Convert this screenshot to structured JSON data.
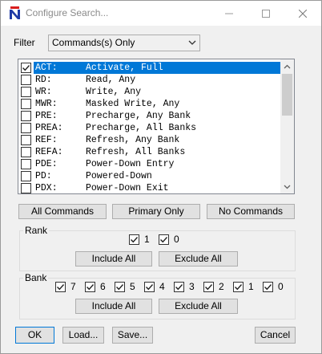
{
  "window": {
    "title": "Configure Search..."
  },
  "filter": {
    "label": "Filter",
    "selected": "Commands(s) Only"
  },
  "commands": [
    {
      "code": "ACT:",
      "desc": "Activate, Full",
      "checked": true,
      "selected": true
    },
    {
      "code": "RD:",
      "desc": "Read, Any",
      "checked": false,
      "selected": false
    },
    {
      "code": "WR:",
      "desc": "Write, Any",
      "checked": false,
      "selected": false
    },
    {
      "code": "MWR:",
      "desc": "Masked Write, Any",
      "checked": false,
      "selected": false
    },
    {
      "code": "PRE:",
      "desc": "Precharge, Any Bank",
      "checked": false,
      "selected": false
    },
    {
      "code": "PREA:",
      "desc": "Precharge, All Banks",
      "checked": false,
      "selected": false
    },
    {
      "code": "REF:",
      "desc": "Refresh, Any Bank",
      "checked": false,
      "selected": false
    },
    {
      "code": "REFA:",
      "desc": "Refresh, All Banks",
      "checked": false,
      "selected": false
    },
    {
      "code": "PDE:",
      "desc": "Power-Down Entry",
      "checked": false,
      "selected": false
    },
    {
      "code": "PD:",
      "desc": "Powered-Down",
      "checked": false,
      "selected": false
    },
    {
      "code": "PDX:",
      "desc": "Power-Down Exit",
      "checked": false,
      "selected": false
    }
  ],
  "selection_buttons": {
    "all": "All Commands",
    "primary": "Primary Only",
    "none": "No Commands"
  },
  "rank": {
    "label": "Rank",
    "items": [
      {
        "label": "1",
        "checked": true
      },
      {
        "label": "0",
        "checked": true
      }
    ],
    "include_all": "Include All",
    "exclude_all": "Exclude All"
  },
  "bank": {
    "label": "Bank",
    "items": [
      {
        "label": "7",
        "checked": true
      },
      {
        "label": "6",
        "checked": true
      },
      {
        "label": "5",
        "checked": true
      },
      {
        "label": "4",
        "checked": true
      },
      {
        "label": "3",
        "checked": true
      },
      {
        "label": "2",
        "checked": true
      },
      {
        "label": "1",
        "checked": true
      },
      {
        "label": "0",
        "checked": true
      }
    ],
    "include_all": "Include All",
    "exclude_all": "Exclude All"
  },
  "footer": {
    "ok": "OK",
    "load": "Load...",
    "save": "Save...",
    "cancel": "Cancel"
  },
  "colors": {
    "selection": "#0078d7",
    "app_icon_blue": "#1f3aa6",
    "app_icon_red": "#d81e1e"
  }
}
